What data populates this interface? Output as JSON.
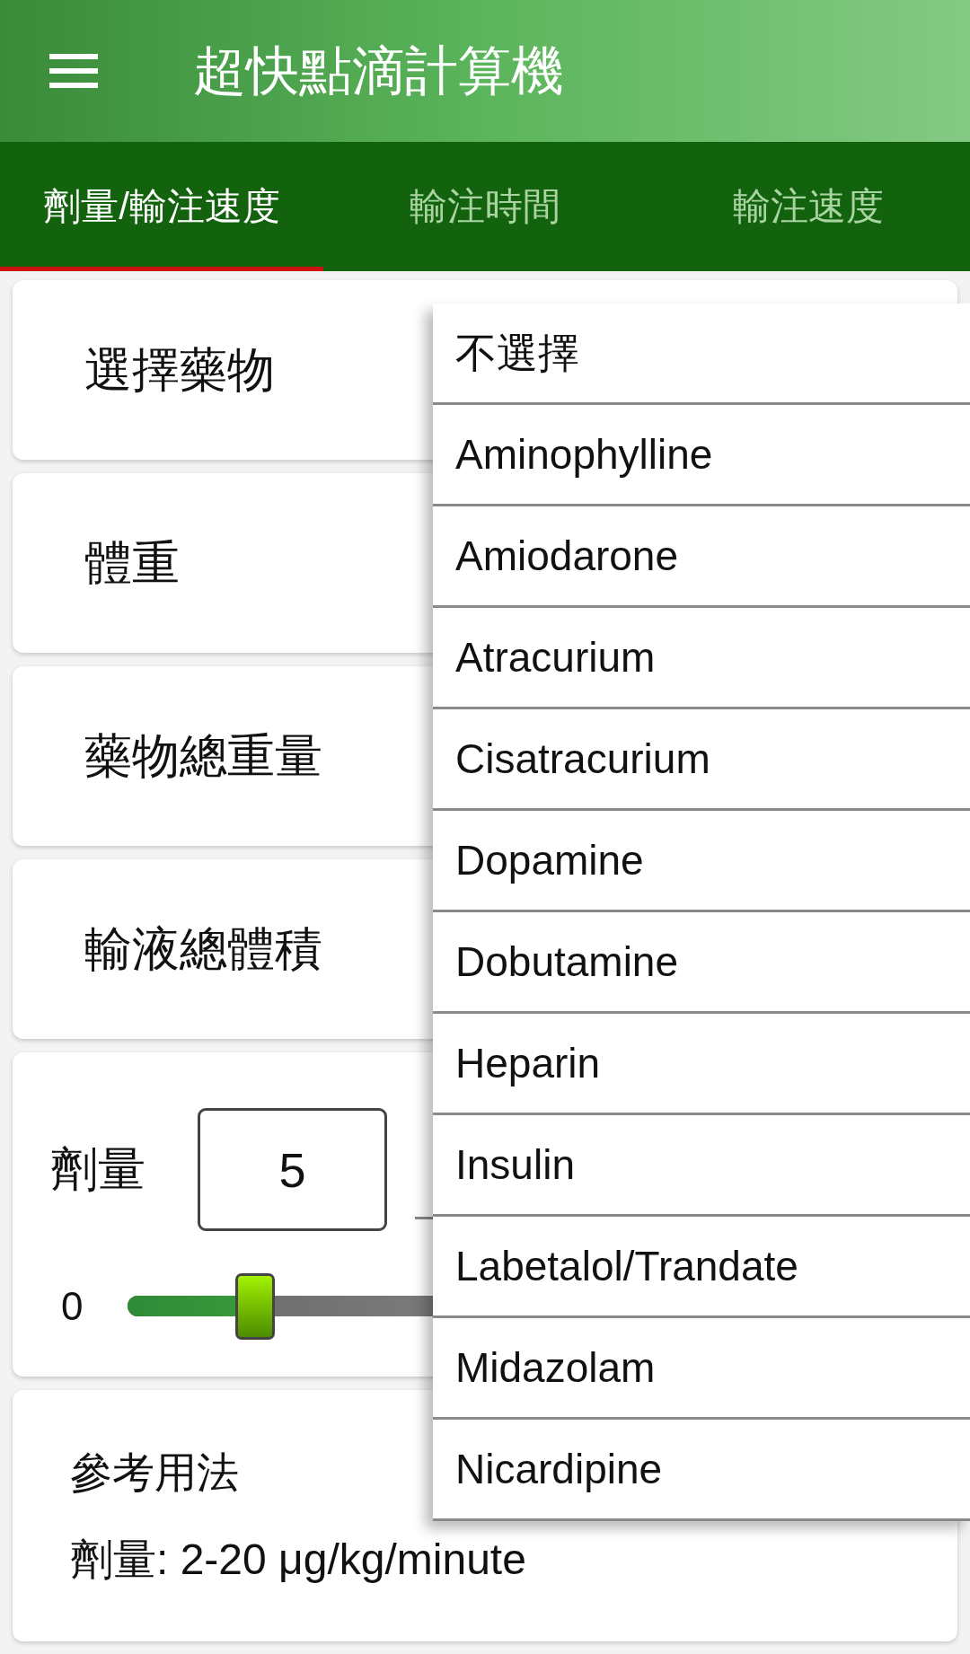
{
  "app_bar": {
    "title": "超快點滴計算機"
  },
  "tabs": [
    {
      "label": "劑量/輸注速度",
      "selected": true
    },
    {
      "label": "輸注時間",
      "selected": false
    },
    {
      "label": "輸注速度",
      "selected": false
    }
  ],
  "fields": [
    {
      "label": "選擇藥物"
    },
    {
      "label": "體重"
    },
    {
      "label": "藥物總重量"
    },
    {
      "label": "輸液總體積"
    }
  ],
  "dose": {
    "label": "劑量",
    "value": "5",
    "slider": {
      "min_label": "0",
      "level": 0.165
    }
  },
  "reference": {
    "title": "參考用法",
    "text": "劑量: 2-20 μg/kg/minute"
  },
  "dropdown": {
    "items": [
      {
        "label": "不選擇"
      },
      {
        "label": "Aminophylline"
      },
      {
        "label": "Amiodarone"
      },
      {
        "label": "Atracurium"
      },
      {
        "label": "Cisatracurium"
      },
      {
        "label": "Dopamine"
      },
      {
        "label": "Dobutamine"
      },
      {
        "label": "Heparin"
      },
      {
        "label": "Insulin"
      },
      {
        "label": "Labetalol/Trandate"
      },
      {
        "label": "Midazolam"
      },
      {
        "label": "Nicardipine"
      }
    ]
  }
}
